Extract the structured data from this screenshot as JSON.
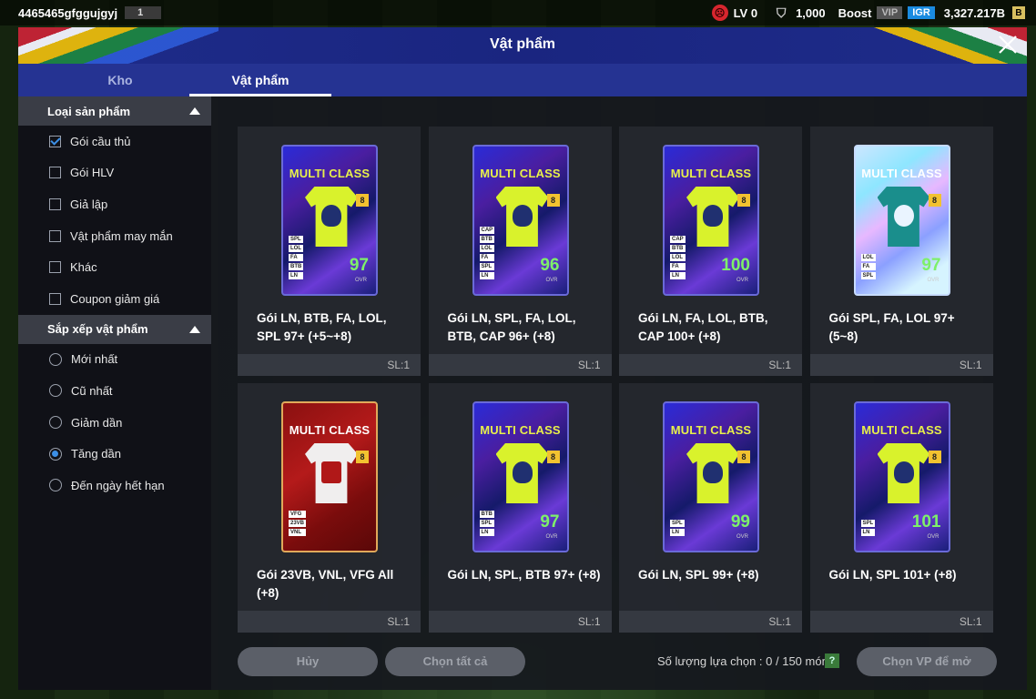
{
  "topbar": {
    "user_id": "4465465gfggujgyj",
    "user_badge": "1",
    "level": "LV 0",
    "points": "1,000",
    "boost": "Boost",
    "vip": "VIP",
    "igr": "IGR",
    "balance": "3,327.217B",
    "bp_icon": "B"
  },
  "modal": {
    "title": "Vật phẩm",
    "tabs": [
      {
        "label": "Kho"
      },
      {
        "label": "Vật phẩm"
      }
    ]
  },
  "sidebar": {
    "category_title": "Loại sản phẩm",
    "categories": [
      {
        "label": "Gói cầu thủ",
        "checked": true
      },
      {
        "label": "Gói HLV",
        "checked": false
      },
      {
        "label": "Giả lập",
        "checked": false
      },
      {
        "label": "Vật phẩm may mắn",
        "checked": false
      },
      {
        "label": "Khác",
        "checked": false
      },
      {
        "label": "Coupon giảm giá",
        "checked": false
      }
    ],
    "sort_title": "Sắp xếp vật phẩm",
    "sorts": [
      {
        "label": "Mới nhất",
        "selected": false
      },
      {
        "label": "Cũ nhất",
        "selected": false
      },
      {
        "label": "Giảm dần",
        "selected": false
      },
      {
        "label": "Tăng dần",
        "selected": true
      },
      {
        "label": "Đến ngày hết hạn",
        "selected": false
      }
    ]
  },
  "items": [
    {
      "pack_label": "MULTI CLASS",
      "level": "8",
      "ovr": "97",
      "ovr_label": "OVR",
      "tags": [
        "SPL",
        "LOL",
        "FA",
        "BTB",
        "LN"
      ],
      "name": "Gói LN, BTB, FA, LOL, SPL 97+ (+5~+8)",
      "qty": "SL:1",
      "style": "blue"
    },
    {
      "pack_label": "MULTI CLASS",
      "level": "8",
      "ovr": "96",
      "ovr_label": "OVR",
      "tags": [
        "CAP",
        "BTB",
        "LOL",
        "FA",
        "SPL",
        "LN"
      ],
      "name": "Gói LN, SPL, FA, LOL, BTB, CAP 96+ (+8)",
      "qty": "SL:1",
      "style": "blue"
    },
    {
      "pack_label": "MULTI CLASS",
      "level": "8",
      "ovr": "100",
      "ovr_label": "OVR",
      "tags": [
        "CAP",
        "BTB",
        "LOL",
        "FA",
        "LN"
      ],
      "name": "Gói LN, FA, LOL, BTB, CAP 100+ (+8)",
      "qty": "SL:1",
      "style": "blue"
    },
    {
      "pack_label": "MULTI CLASS",
      "level": "8",
      "ovr": "97",
      "ovr_label": "OVR",
      "tags": [
        "LOL",
        "FA",
        "SPL"
      ],
      "name": "Gói SPL, FA, LOL 97+ (5~8)",
      "qty": "SL:1",
      "style": "holo"
    },
    {
      "pack_label": "MULTI CLASS",
      "level": "8",
      "ovr": "",
      "ovr_label": "",
      "tags": [
        "VFG",
        "23VB",
        "VNL"
      ],
      "name": "Gói 23VB, VNL, VFG All (+8)",
      "qty": "SL:1",
      "style": "red"
    },
    {
      "pack_label": "MULTI CLASS",
      "level": "8",
      "ovr": "97",
      "ovr_label": "OVR",
      "tags": [
        "BTB",
        "SPL",
        "LN"
      ],
      "name": "Gói LN, SPL, BTB 97+ (+8)",
      "qty": "SL:1",
      "style": "blue"
    },
    {
      "pack_label": "MULTI CLASS",
      "level": "8",
      "ovr": "99",
      "ovr_label": "OVR",
      "tags": [
        "SPL",
        "LN"
      ],
      "name": "Gói LN, SPL 99+ (+8)",
      "qty": "SL:1",
      "style": "blue"
    },
    {
      "pack_label": "MULTI CLASS",
      "level": "8",
      "ovr": "101",
      "ovr_label": "OVR",
      "tags": [
        "SPL",
        "LN"
      ],
      "name": "Gói LN, SPL 101+ (+8)",
      "qty": "SL:1",
      "style": "blue"
    }
  ],
  "footer": {
    "cancel": "Hủy",
    "select_all": "Chọn tất cả",
    "count": "Số lượng lựa chọn : 0 / 150 món",
    "help": "?",
    "choose_vp": "Chọn VP để mở"
  },
  "colors": {
    "accent": "#3c8fe6",
    "header": "#1e2c8a",
    "ovr": "#7ef06a"
  }
}
